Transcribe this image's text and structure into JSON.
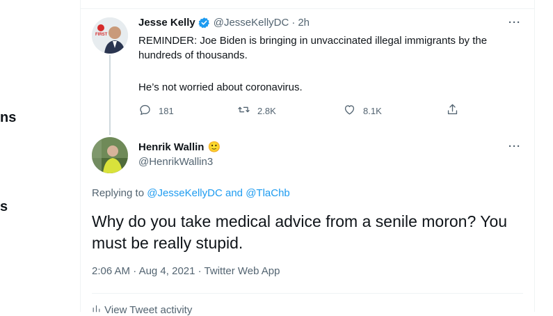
{
  "left_nav": {
    "frag1": "ns",
    "frag2": "s"
  },
  "parent_tweet": {
    "display_name": "Jesse Kelly",
    "handle": "@JesseKellyDC",
    "separator": "·",
    "time": "2h",
    "more": "···",
    "avatar_badge": "FIRST",
    "text_line1": "REMINDER: Joe Biden is bringing in unvaccinated illegal immigrants by the hundreds of thousands.",
    "text_line2": "He’s not worried about coronavirus.",
    "replies": "181",
    "retweets": "2.8K",
    "likes": "8.1K"
  },
  "reply_tweet": {
    "display_name": "Henrik Wallin",
    "emoji": "🙂",
    "handle": "@HenrikWallin3",
    "more": "···",
    "replying_prefix": "Replying to",
    "replying_user1": "@JesseKellyDC",
    "replying_and": "and",
    "replying_user2": "@TlaChb",
    "text": "Why do you take medical advice from a senile moron? You must be really stupid.",
    "time": "2:06 AM",
    "date": "Aug 4, 2021",
    "source": "Twitter Web App",
    "separator": "·",
    "activity": "View Tweet activity"
  },
  "colors": {
    "accent": "#1d9bf0",
    "secondary_text": "#536471",
    "primary_text": "#0f1419",
    "border": "#eff3f4"
  },
  "icons": [
    "verified-badge-icon",
    "reply-icon",
    "retweet-icon",
    "like-icon",
    "share-icon",
    "more-icon",
    "activity-icon"
  ]
}
